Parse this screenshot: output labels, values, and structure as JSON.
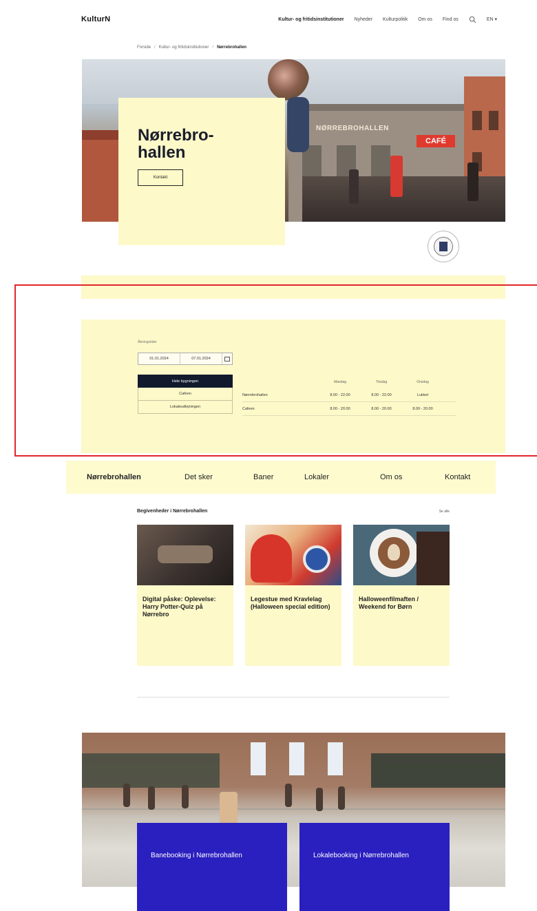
{
  "header": {
    "logo": "KulturN",
    "nav": [
      "Kultur- og fritidsinstitutioner",
      "Nyheder",
      "Kulturpolitik",
      "Om os",
      "Find os"
    ],
    "lang": "EN ▾"
  },
  "breadcrumb": [
    "Forside",
    "Kultur- og fritidsinstitutioner",
    "Nørrebrohallen"
  ],
  "hero": {
    "title": "Nørrebro-hallen",
    "intro": "",
    "cta_label": "Kontakt",
    "photo_sign": "NØRREBROHALLEN",
    "cafe_sign": "CAFÉ",
    "caption": ""
  },
  "hours": {
    "section_label": "Åbningstider",
    "date_from": "01.01.2024",
    "date_to": "07.01.2024",
    "options": [
      {
        "label": "Hele bygningen",
        "active": true
      },
      {
        "label": "Cafeen",
        "active": false
      },
      {
        "label": "Lokaleudlejningen",
        "active": false
      }
    ],
    "columns": [
      "",
      "Mandag",
      "Tirsdag",
      "Onsdag"
    ],
    "rows": [
      [
        "Nørrebrohallen",
        "8.00 - 22.00",
        "8.00 - 22.00",
        "Lukket"
      ],
      [
        "Cafeen",
        "8.00 - 20.00",
        "8.00 - 20.00",
        "8.00 - 20.00"
      ]
    ]
  },
  "subnav": {
    "tabs": [
      "Nørrebrohallen",
      "Det sker",
      "Baner",
      "Lokaler",
      "Om os",
      "Kontakt"
    ],
    "active_index": 0
  },
  "events": {
    "heading": "Begivenheder i Nørrebrohallen",
    "see_all": "Se alle",
    "cards": [
      {
        "tag": "",
        "title": "Digital påske: Oplevelse: Harry Potter-Quiz på Nørrebro",
        "date": "",
        "location": ""
      },
      {
        "tag": "",
        "title": "Legestue med Kravlelag (Halloween special edition)",
        "date": "",
        "location": ""
      },
      {
        "tag": "",
        "title": "Halloweenfilmaften / Weekend for Børn",
        "date": "",
        "location": ""
      }
    ]
  },
  "booking": {
    "cards": [
      {
        "tag": "",
        "title": "Banebooking i Nørrebrohallen",
        "desc": ""
      },
      {
        "tag": "",
        "title": "Lokalebooking i Nørrebrohallen",
        "desc": ""
      }
    ]
  },
  "colors": {
    "cream": "#fdf9c9",
    "navy": "#121a2e",
    "booking_blue": "#2a1fbf",
    "highlight_red": "#e3262b"
  },
  "icons": {
    "search": "search-icon",
    "calendar": "calendar-icon",
    "seal": "city-seal-icon"
  }
}
